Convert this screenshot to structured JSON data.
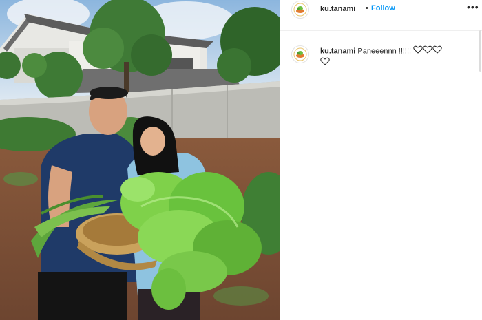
{
  "post": {
    "photo": {
      "subject": "two-people-holding-basket-of-vegetables-icon"
    },
    "header": {
      "username": "ku.tanami",
      "separator": "•",
      "follow_label": "Follow",
      "more_icon": "ellipsis-icon"
    },
    "caption": {
      "username": "ku.tanami",
      "text": "Paneeennn !!!!!!",
      "hearts": [
        "heart-outline-icon",
        "heart-outline-icon",
        "heart-outline-icon",
        "heart-outline-icon"
      ]
    }
  },
  "colors": {
    "follow": "#0095f6",
    "text": "#262626",
    "divider": "#efefef"
  }
}
